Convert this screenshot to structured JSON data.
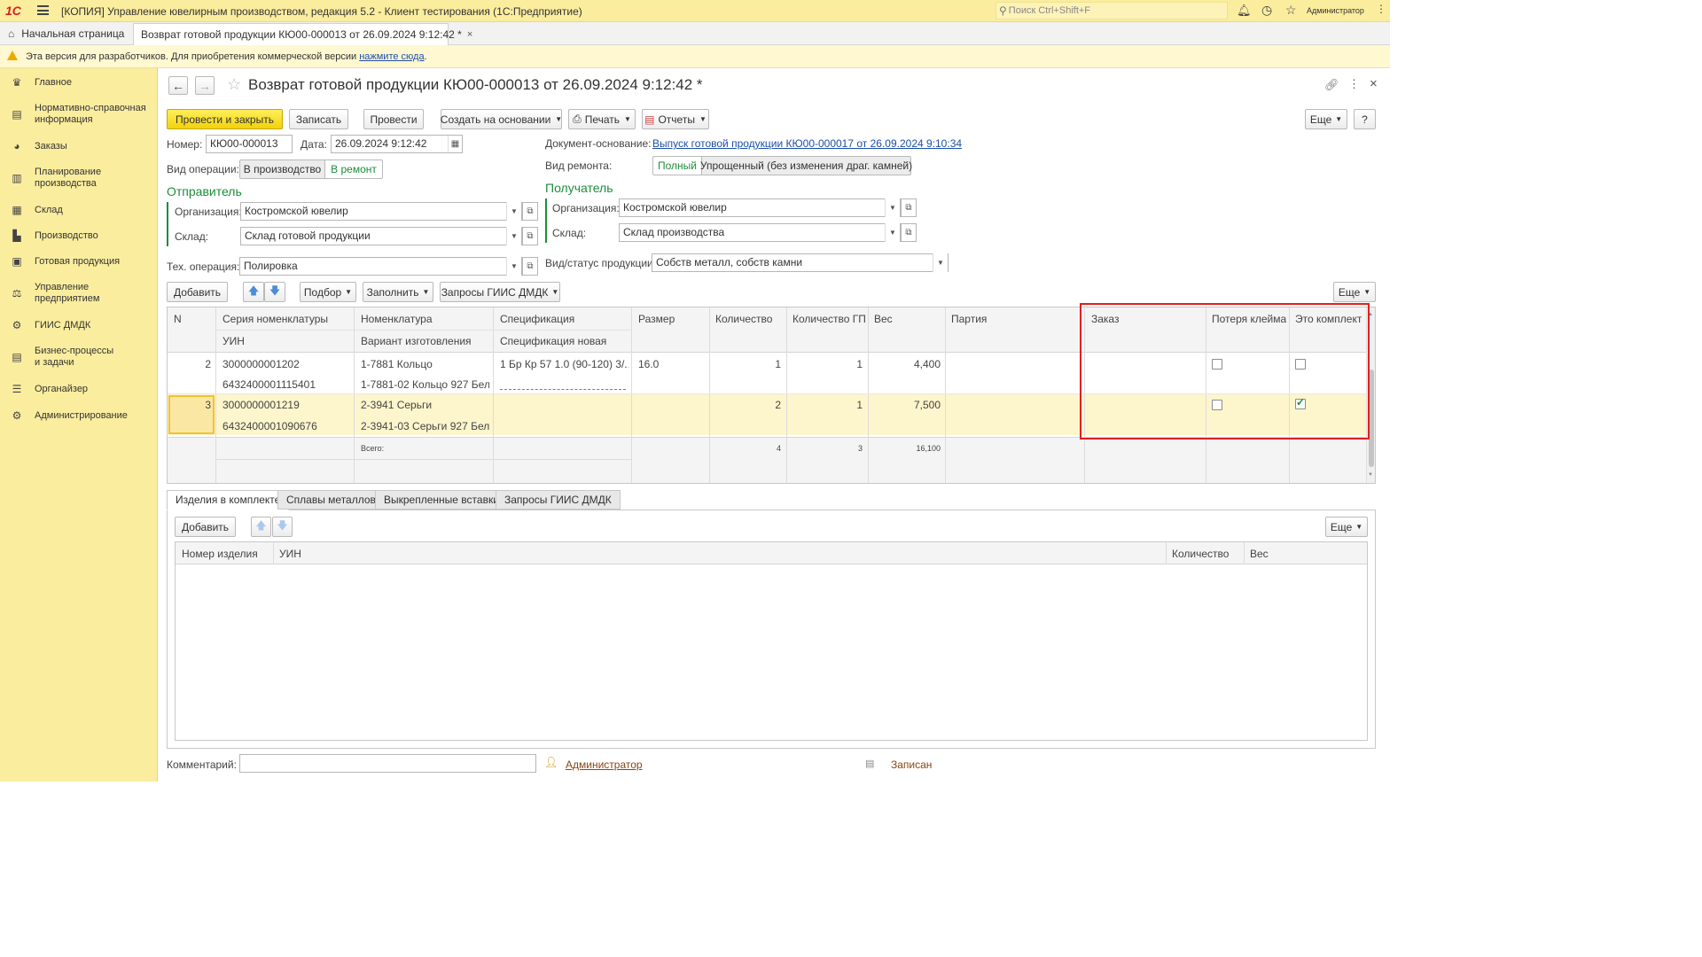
{
  "topbar": {
    "logo": "1С",
    "menu_icon": "hamburger-icon",
    "title": "[КОПИЯ] Управление ювелирным производством, редакция 5.2  - Клиент тестирования (1С:Предприятие)",
    "search_placeholder": "Поиск Ctrl+Shift+F",
    "user": "Администратор"
  },
  "tabs": {
    "home": "Начальная страница",
    "active": "Возврат готовой продукции КЮ00-000013 от 26.09.2024 9:12:42 *"
  },
  "warning": {
    "text": "Эта версия для разработчиков. Для приобретения коммерческой версии",
    "link": "нажмите сюда",
    "tail": "."
  },
  "sidebar": {
    "items": [
      {
        "label": "Главное",
        "icon": "crown-icon"
      },
      {
        "label": "Нормативно-справочная информация",
        "icon": "book-icon"
      },
      {
        "label": "Заказы",
        "icon": "pie-chart-icon"
      },
      {
        "label": "Планирование производства",
        "icon": "clipboard-icon"
      },
      {
        "label": "Склад",
        "icon": "grid-icon"
      },
      {
        "label": "Производство",
        "icon": "factory-icon"
      },
      {
        "label": "Готовая продукция",
        "icon": "box-icon"
      },
      {
        "label": "Управление предприятием",
        "icon": "enterprise-icon"
      },
      {
        "label": "ГИИС ДМДК",
        "icon": "gear-chain-icon"
      },
      {
        "label": "Бизнес-процессы и задачи",
        "icon": "tasks-icon"
      },
      {
        "label": "Органайзер",
        "icon": "organizer-icon"
      },
      {
        "label": "Администрирование",
        "icon": "gear-icon"
      }
    ]
  },
  "doc": {
    "title": "Возврат готовой продукции КЮ00-000013 от 26.09.2024 9:12:42 *"
  },
  "toolbar": {
    "post_close": "Провести и закрыть",
    "save": "Записать",
    "post": "Провести",
    "create_based": "Создать на основании",
    "print": "Печать",
    "reports": "Отчеты",
    "more": "Еще",
    "help": "?"
  },
  "header": {
    "number_label": "Номер:",
    "number": "КЮ00-000013",
    "date_label": "Дата:",
    "date": "26.09.2024  9:12:42",
    "base_label": "Документ-основание:",
    "base_link": "Выпуск готовой продукции КЮ00-000017 от 26.09.2024 9:10:34",
    "op_label": "Вид операции:",
    "op_opt1": "В производство",
    "op_opt2": "В ремонт",
    "repair_label": "Вид ремонта:",
    "repair_opt1": "Полный",
    "repair_opt2": "Упрощенный (без изменения драг. камней)",
    "sender_title": "Отправитель",
    "receiver_title": "Получатель",
    "org_label": "Организация:",
    "wh_label": "Склад:",
    "sender_org": "Костромской ювелир",
    "sender_wh": "Склад готовой продукции",
    "receiver_org": "Костромской ювелир",
    "receiver_wh": "Склад производства",
    "techop_label": "Тех. операция:",
    "techop": "Полировка",
    "status_label": "Вид/статус продукции:",
    "status": "Собств металл, собств камни"
  },
  "table_toolbar": {
    "add": "Добавить",
    "pick": "Подбор",
    "fill": "Заполнить",
    "giis": "Запросы ГИИС ДМДК",
    "more": "Еще"
  },
  "table": {
    "headers": {
      "n": "N",
      "series": "Серия номенклатуры",
      "uin": "УИН",
      "nom": "Номенклатура",
      "variant": "Вариант изготовления",
      "spec": "Спецификация",
      "spec_new": "Спецификация новая",
      "size": "Размер",
      "qty": "Количество",
      "qty_gp": "Количество ГП",
      "weight": "Вес",
      "batch": "Партия",
      "order": "Заказ",
      "loss": "Потеря клейма",
      "kit": "Это комплект"
    },
    "rows": [
      {
        "n": "2",
        "series": "3000000001202",
        "uin": "6432400001115401",
        "nom": "1-7881 Кольцо",
        "variant": "1-7881-02 Кольцо 927 Бел...",
        "spec": "1 Бр Кр 57 1.0 (90-120) 3/...",
        "size": "16.0",
        "qty": "1",
        "qty_gp": "1",
        "weight": "4,400",
        "loss": false,
        "kit": false
      },
      {
        "n": "3",
        "series": "3000000001219",
        "uin": "6432400001090676",
        "nom": "2-3941 Серьги",
        "variant": "2-3941-03 Серьги 927 Бел...",
        "spec": "",
        "size": "",
        "qty": "2",
        "qty_gp": "1",
        "weight": "7,500",
        "loss": false,
        "kit": true
      }
    ],
    "footer": {
      "label": "Всего:",
      "qty": "4",
      "qty_gp": "3",
      "weight": "16,100"
    }
  },
  "bottom_tabs": [
    "Изделия в комплекте",
    "Сплавы металлов",
    "Выкрепленные вставки",
    "Запросы ГИИС ДМДК"
  ],
  "kit_table": {
    "add": "Добавить",
    "more": "Еще",
    "headers": {
      "num": "Номер изделия",
      "uin": "УИН",
      "qty": "Количество",
      "weight": "Вес"
    }
  },
  "footer": {
    "comment_label": "Комментарий:",
    "author": "Администратор",
    "status": "Записан"
  },
  "colors": {
    "highlight": "#e02020",
    "selected_row": "#fdf5cc",
    "accent_green": "#1c8d3a"
  }
}
